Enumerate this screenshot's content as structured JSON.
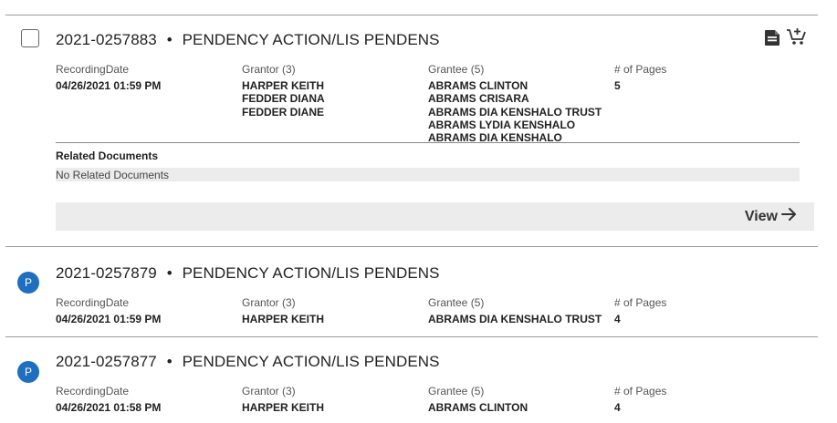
{
  "records": [
    {
      "number": "2021-0257883",
      "separator": "•",
      "doc_type": "PENDENCY ACTION/LIS PENDENS",
      "labels": {
        "recording_date": "RecordingDate",
        "grantor": "Grantor (3)",
        "grantee": "Grantee (5)",
        "pages": "# of Pages"
      },
      "recording_date": "04/26/2021 01:59 PM",
      "grantors": [
        "HARPER KEITH",
        "FEDDER DIANA",
        "FEDDER DIANE"
      ],
      "grantees": [
        "ABRAMS CLINTON",
        "ABRAMS CRISARA",
        "ABRAMS DIA KENSHALO TRUST",
        "ABRAMS LYDIA KENSHALO",
        "ABRAMS DIA KENSHALO"
      ],
      "pages": "5",
      "related_title": "Related Documents",
      "related_text": "No Related Documents",
      "view_label": "View"
    },
    {
      "badge": "P",
      "number": "2021-0257879",
      "separator": "•",
      "doc_type": "PENDENCY ACTION/LIS PENDENS",
      "labels": {
        "recording_date": "RecordingDate",
        "grantor": "Grantor (3)",
        "grantee": "Grantee (5)",
        "pages": "# of Pages"
      },
      "recording_date": "04/26/2021 01:59 PM",
      "grantors": [
        "HARPER KEITH"
      ],
      "grantees": [
        "ABRAMS DIA KENSHALO TRUST"
      ],
      "pages": "4"
    },
    {
      "badge": "P",
      "number": "2021-0257877",
      "separator": "•",
      "doc_type": "PENDENCY ACTION/LIS PENDENS",
      "labels": {
        "recording_date": "RecordingDate",
        "grantor": "Grantor (3)",
        "grantee": "Grantee (5)",
        "pages": "# of Pages"
      },
      "recording_date": "04/26/2021 01:58 PM",
      "grantors": [
        "HARPER KEITH"
      ],
      "grantees": [
        "ABRAMS CLINTON"
      ],
      "pages": "4"
    }
  ],
  "icons": {
    "document": "document-icon",
    "cart": "add-to-cart-icon",
    "arrow": "arrow-right-icon"
  },
  "colors": {
    "badge": "#1f6fbf",
    "bar": "#ececec"
  }
}
